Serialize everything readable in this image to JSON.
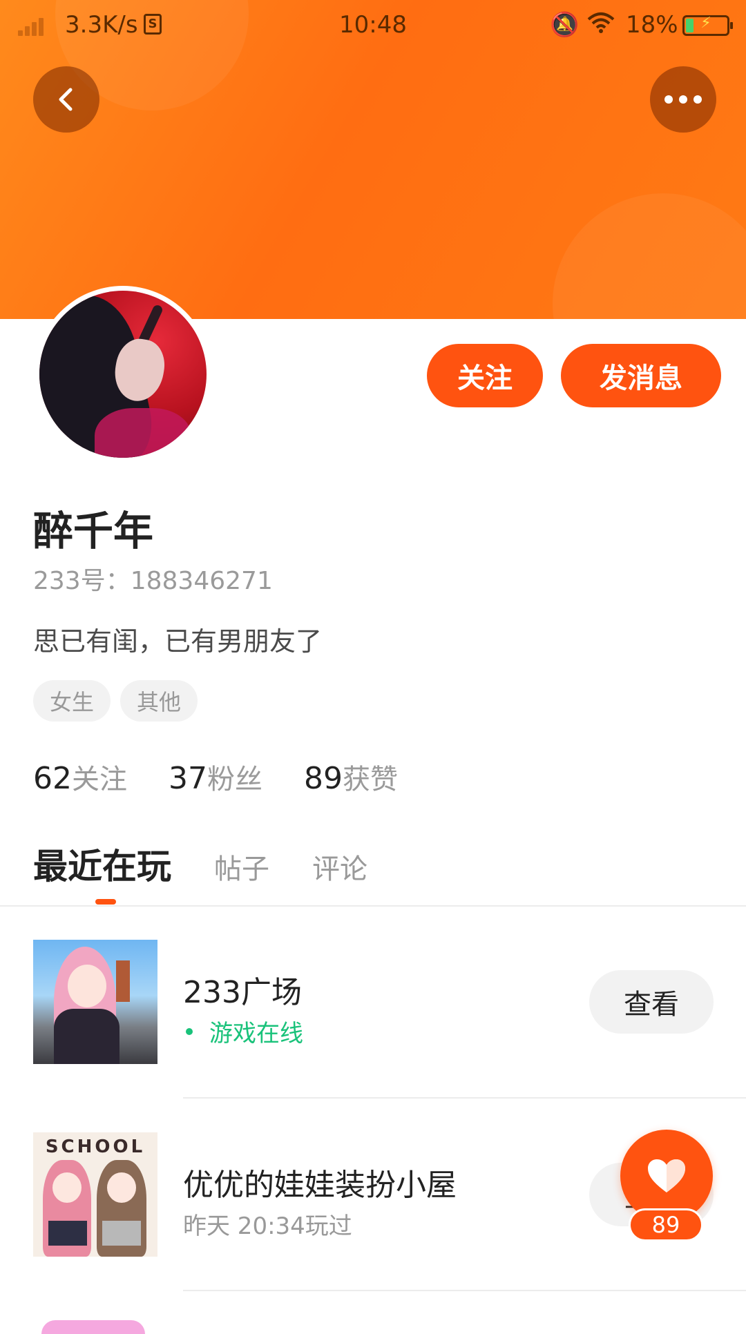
{
  "status_bar": {
    "speed": "3.3K/s",
    "time": "10:48",
    "battery_percent": "18%",
    "battery_level": 0.18,
    "icons": [
      "signal-icon",
      "sim-icon",
      "silent-bell-icon",
      "wifi-icon",
      "battery-charging-icon"
    ]
  },
  "header": {
    "back_icon": "chevron-left-icon",
    "more_icon": "more-dots-icon",
    "accent_color": "#ff6d12"
  },
  "profile": {
    "name": "醉千年",
    "uid": "233号：188346271",
    "bio": "思已有闺，已有男朋友了",
    "tags": [
      "女生",
      "其他"
    ],
    "follow_label": "关注",
    "message_label": "发消息"
  },
  "stats": [
    {
      "num": "62",
      "label": "关注"
    },
    {
      "num": "37",
      "label": "粉丝"
    },
    {
      "num": "89",
      "label": "获赞"
    }
  ],
  "tabs": [
    {
      "label": "最近在玩",
      "active": true
    },
    {
      "label": "帖子",
      "active": false
    },
    {
      "label": "评论",
      "active": false
    }
  ],
  "games": [
    {
      "title": "233广场",
      "subtitle": "游戏在线",
      "online": true,
      "button": "查看"
    },
    {
      "title": "优优的娃娃装扮小屋",
      "subtitle": "昨天 20:34玩过",
      "online": false,
      "button": "查看",
      "thumb_text": "SCHOOL"
    }
  ],
  "like_fab": {
    "icon": "heart-icon",
    "count": "89"
  }
}
